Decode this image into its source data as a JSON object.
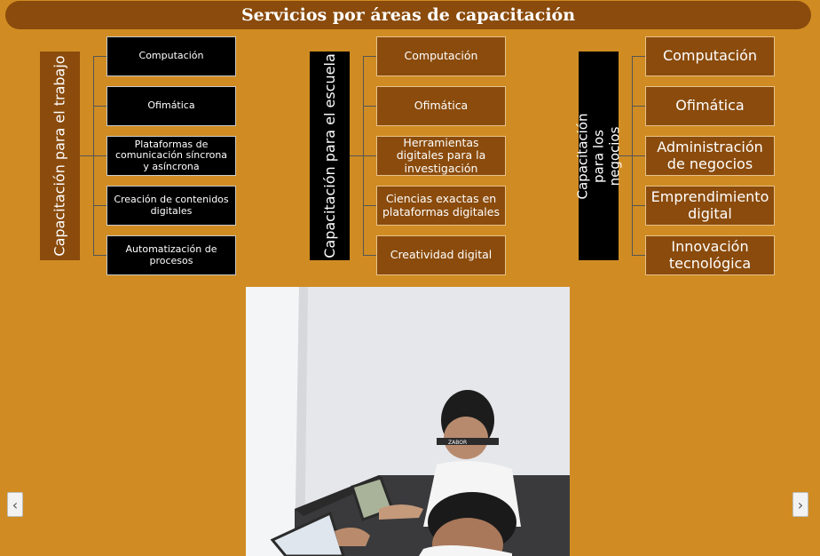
{
  "title": "Servicios por áreas de capacitación",
  "columns": [
    {
      "label": "Capacitación para el trabajo",
      "items": [
        "Computación",
        "Ofimática",
        "Plataformas de comunicación síncrona y asíncrona",
        "Creación de contenidos digitales",
        "Automatización de procesos"
      ]
    },
    {
      "label": "Capacitación para el escuela",
      "items": [
        "Computación",
        "Ofimática",
        "Herramientas digitales para la investigación",
        "Ciencias exactas en plataformas digitales",
        "Creatividad digital"
      ]
    },
    {
      "label": "Capacitación para los negocios",
      "items": [
        "Computación",
        "Ofimática",
        "Administración de negocios",
        "Emprendimiento digital",
        "Innovación tecnológica"
      ]
    }
  ],
  "photo": {
    "headband_text": "ZABOR"
  },
  "nav": {
    "prev": "‹",
    "next": "›"
  },
  "colors": {
    "background": "#d08c22",
    "brown": "#8a4b0c",
    "black": "#000000"
  },
  "icons": {
    "prev": "chevron-left-icon",
    "next": "chevron-right-icon"
  }
}
